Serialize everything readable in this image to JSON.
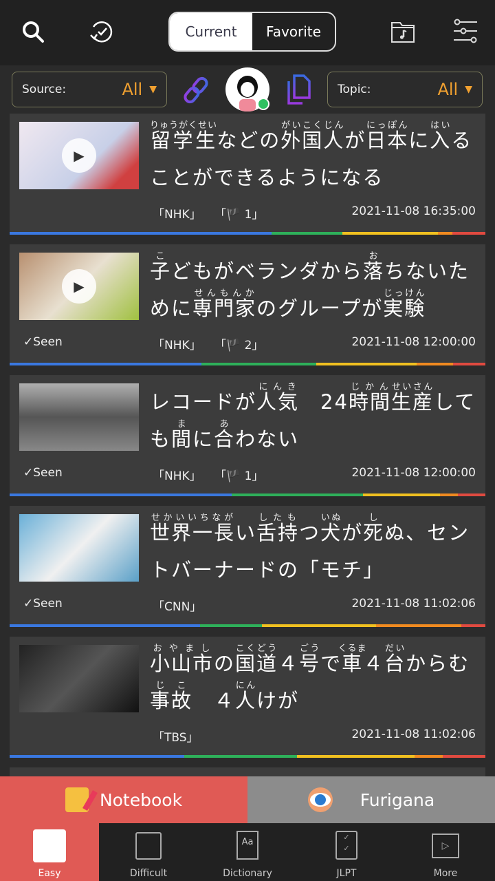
{
  "header": {
    "tabs": [
      {
        "label": "Current",
        "active": true
      },
      {
        "label": "Favorite",
        "active": false
      }
    ],
    "icons": [
      "search-icon",
      "history-icon",
      "music-folder-icon",
      "settings-sliders-icon"
    ]
  },
  "filters": {
    "source_label": "Source:",
    "source_value": "All",
    "topic_label": "Topic:",
    "topic_value": "All"
  },
  "colors": {
    "accent": "#f0a030",
    "notebook": "#e05a55",
    "furigana": "#8c8c8c",
    "card": "#3c3c3c"
  },
  "articles": [
    {
      "seen": "",
      "source": "「NHK」",
      "level": "「🏴 1」",
      "date": "2021-11-08 16:35:00",
      "video": true,
      "title": [
        [
          "留学生",
          "りゅうがくせい"
        ],
        [
          "など",
          ""
        ],
        [
          "の",
          ""
        ],
        [
          "外国人",
          "がいこくじん"
        ],
        [
          "が",
          ""
        ],
        [
          "日本",
          "にっぽん"
        ],
        [
          "に",
          ""
        ],
        [
          "入",
          "はい"
        ],
        [
          "ることができるようになる",
          ""
        ]
      ]
    },
    {
      "seen": "✓Seen",
      "source": "「NHK」",
      "level": "「🏴 2」",
      "date": "2021-11-08 12:00:00",
      "video": true,
      "title": [
        [
          "子",
          "こ"
        ],
        [
          "どもがベランダから",
          ""
        ],
        [
          "落",
          "お"
        ],
        [
          "ちないために",
          ""
        ],
        [
          "専門家",
          "せんもんか"
        ],
        [
          "のグループが",
          ""
        ],
        [
          "実験",
          "じっけん"
        ]
      ]
    },
    {
      "seen": "✓Seen",
      "source": "「NHK」",
      "level": "「🏴 1」",
      "date": "2021-11-08 12:00:00",
      "video": false,
      "title": [
        [
          "レコードが",
          ""
        ],
        [
          "人気",
          "にんき"
        ],
        [
          "　24",
          ""
        ],
        [
          "時間",
          "じかん"
        ],
        [
          "生産",
          "せいさん"
        ],
        [
          "しても",
          ""
        ],
        [
          "間",
          "ま"
        ],
        [
          "に",
          ""
        ],
        [
          "合",
          "あ"
        ],
        [
          "わない",
          ""
        ]
      ]
    },
    {
      "seen": "✓Seen",
      "source": "「CNN」",
      "level": "",
      "date": "2021-11-08 11:02:06",
      "video": false,
      "title": [
        [
          "世界一長",
          "せかいいちなが"
        ],
        [
          "い",
          ""
        ],
        [
          "舌持",
          "したも"
        ],
        [
          "つ",
          ""
        ],
        [
          "犬",
          "いぬ"
        ],
        [
          "が",
          ""
        ],
        [
          "死",
          "し"
        ],
        [
          "ぬ、セントバーナードの「モチ」",
          ""
        ]
      ]
    },
    {
      "seen": "",
      "source": "「TBS」",
      "level": "",
      "date": "2021-11-08 11:02:06",
      "video": false,
      "title": [
        [
          "小山市",
          "おやまし"
        ],
        [
          "の",
          ""
        ],
        [
          "国道",
          "こくどう"
        ],
        [
          "４",
          ""
        ],
        [
          "号",
          "ごう"
        ],
        [
          "で",
          ""
        ],
        [
          "車",
          "くるま"
        ],
        [
          "４",
          ""
        ],
        [
          "台",
          "だい"
        ],
        [
          "から",
          ""
        ],
        [
          "む",
          ""
        ],
        [
          "事故",
          "じこ"
        ],
        [
          "　４",
          ""
        ],
        [
          "人",
          "にん"
        ],
        [
          "けが",
          ""
        ]
      ]
    }
  ],
  "actions": {
    "notebook": "Notebook",
    "furigana": "Furigana"
  },
  "nav": [
    {
      "label": "Easy",
      "active": true
    },
    {
      "label": "Difficult"
    },
    {
      "label": "Dictionary"
    },
    {
      "label": "JLPT"
    },
    {
      "label": "More"
    }
  ]
}
